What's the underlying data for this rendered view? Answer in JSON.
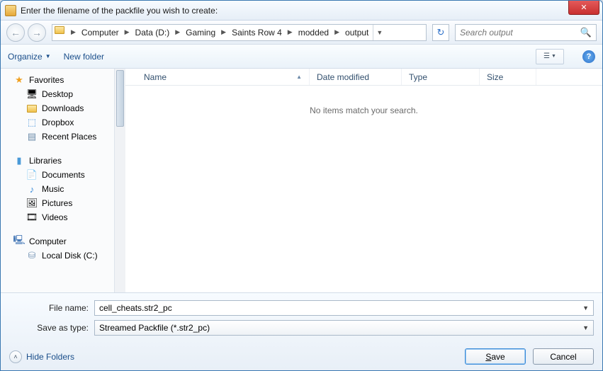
{
  "titlebar": {
    "text": "Enter the filename of the packfile you wish to create:"
  },
  "breadcrumb": [
    "Computer",
    "Data (D:)",
    "Gaming",
    "Saints Row 4",
    "modded",
    "output"
  ],
  "search": {
    "placeholder": "Search output"
  },
  "toolbar": {
    "organize": "Organize",
    "newfolder": "New folder"
  },
  "tree": {
    "favorites": {
      "label": "Favorites",
      "children": [
        "Desktop",
        "Downloads",
        "Dropbox",
        "Recent Places"
      ]
    },
    "libraries": {
      "label": "Libraries",
      "children": [
        "Documents",
        "Music",
        "Pictures",
        "Videos"
      ]
    },
    "computer": {
      "label": "Computer",
      "children": [
        "Local Disk (C:)"
      ]
    }
  },
  "columns": {
    "name": "Name",
    "date": "Date modified",
    "type": "Type",
    "size": "Size"
  },
  "empty": "No items match your search.",
  "filename": {
    "label": "File name:",
    "value": "cell_cheats.str2_pc"
  },
  "saveas": {
    "label": "Save as type:",
    "value": "Streamed Packfile (*.str2_pc)"
  },
  "hide_folders": "Hide Folders",
  "buttons": {
    "save": "Save",
    "cancel": "Cancel"
  }
}
